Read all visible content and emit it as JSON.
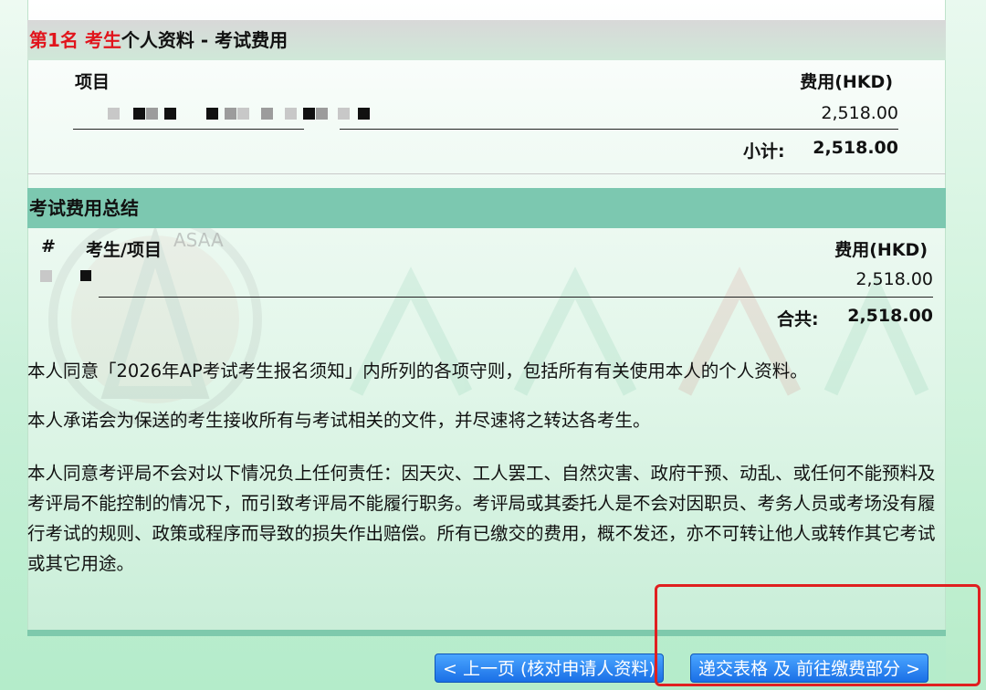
{
  "section1": {
    "rank": "第1名",
    "candidate": "考生",
    "title": "个人资料 - 考试费用",
    "col_item": "项目",
    "col_fee": "费用(HKD)",
    "row_amount": "2,518.00",
    "subtotal_label": "小计:",
    "subtotal_value": "2,518.00"
  },
  "section2": {
    "title": "考试费用总结",
    "col_num": "#",
    "col_item": "考生/项目",
    "col_fee": "费用(HKD)",
    "row_amount": "2,518.00",
    "total_label": "合共:",
    "total_value": "2,518.00"
  },
  "watermark": {
    "text": "ASAA"
  },
  "terms": {
    "p1": "本人同意「2026年AP考试考生报名须知」内所列的各项守则，包括所有有关使用本人的个人资料。",
    "p2": "本人承诺会为保送的考生接收所有与考试相关的文件，并尽速将之转达各考生。",
    "p3": "本人同意考评局不会对以下情况负上任何责任：因天灾、工人罢工、自然灾害、政府干预、动乱、或任何不能预料及考评局不能控制的情况下，而引致考评局不能履行职务。考评局或其委托人是不会对因职员、考务人员或考场没有履行考试的规则、政策或程序而导致的损失作出赔偿。所有已缴交的费用，概不发还，亦不可转让他人或转作其它考试或其它用途。"
  },
  "buttons": {
    "prev": "< 上一页 (核对申请人资料)",
    "submit": "递交表格 及 前往缴费部分 >"
  },
  "colors": {
    "header_grey": "#d8d8d8",
    "header_teal": "#7cc8b0",
    "accent_red": "#e1141c",
    "button_blue": "#2a86f0",
    "highlight_red": "#e02020"
  }
}
